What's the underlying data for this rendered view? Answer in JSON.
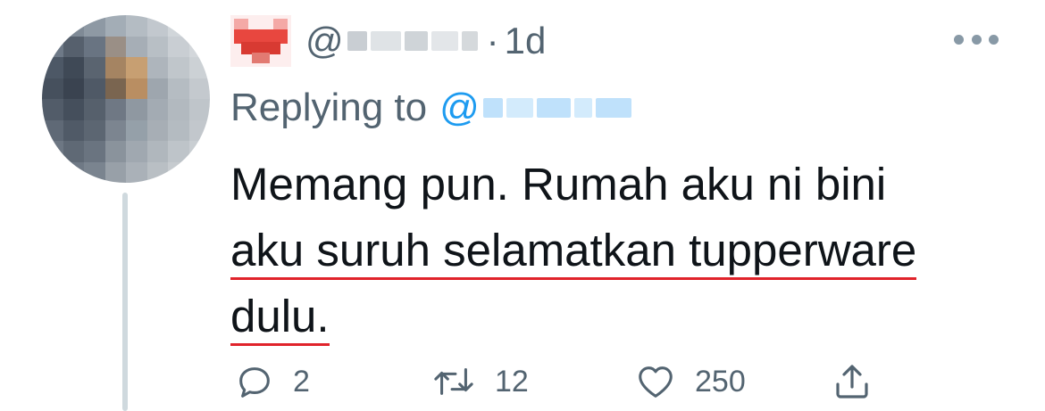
{
  "tweet": {
    "handle_prefix": "@",
    "dot": "·",
    "time": "1d",
    "replying_label": "Replying to",
    "reply_mention_prefix": "@",
    "body_lines": [
      "Memang pun. Rumah aku ni bini",
      "aku suruh selamatkan tupperware",
      "dulu."
    ]
  },
  "actions": {
    "reply_count": "2",
    "retweet_count": "12",
    "like_count": "250"
  },
  "icons": {
    "name_emoji": "red-heart-icon",
    "more": "more-dots-icon",
    "reply": "reply-bubble-icon",
    "retweet": "retweet-icon",
    "like": "heart-outline-icon",
    "share": "share-icon"
  },
  "colors": {
    "text": "#0f1419",
    "secondary": "#536471",
    "mention": "#1d9bf0",
    "spellcheck": "#e0232b"
  }
}
